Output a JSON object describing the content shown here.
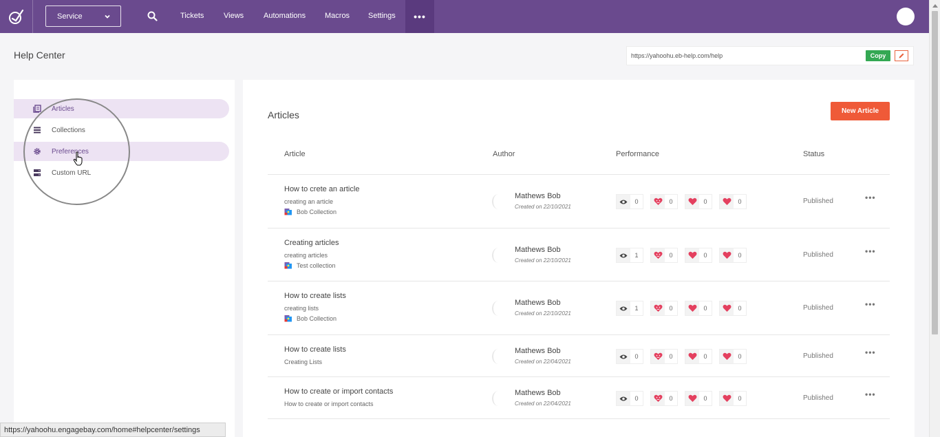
{
  "nav": {
    "service_label": "Service",
    "links": [
      "Tickets",
      "Views",
      "Automations",
      "Macros",
      "Settings"
    ],
    "more_label": "•••"
  },
  "header": {
    "title": "Help Center",
    "url": "https://yahoohu.eb-help.com/help",
    "copy_label": "Copy"
  },
  "sidebar": {
    "items": [
      {
        "label": "Articles",
        "icon": "articles-icon"
      },
      {
        "label": "Collections",
        "icon": "collections-icon"
      },
      {
        "label": "Preferences",
        "icon": "gear-icon"
      },
      {
        "label": "Custom URL",
        "icon": "server-icon"
      }
    ]
  },
  "main": {
    "title": "Articles",
    "new_button": "New Article",
    "columns": [
      "Article",
      "Author",
      "Performance",
      "Status"
    ],
    "rows": [
      {
        "title": "How to crete an article",
        "subtitle": "creating an article",
        "collection": "Bob Collection",
        "author": "Mathews Bob",
        "created": "Created on 22/10/2021",
        "views": "0",
        "r1": "0",
        "r2": "0",
        "r3": "0",
        "status": "Published"
      },
      {
        "title": "Creating articles",
        "subtitle": "creating articles",
        "collection": "Test collection",
        "author": "Mathews Bob",
        "created": "Created on 22/10/2021",
        "views": "1",
        "r1": "0",
        "r2": "0",
        "r3": "0",
        "status": "Published"
      },
      {
        "title": "How to create lists",
        "subtitle": "creating lists",
        "collection": "Bob Collection",
        "author": "Mathews Bob",
        "created": "Created on 22/10/2021",
        "views": "1",
        "r1": "0",
        "r2": "0",
        "r3": "0",
        "status": "Published"
      },
      {
        "title": "How to create lists",
        "subtitle": "Creating Lists",
        "collection": "",
        "author": "Mathews Bob",
        "created": "Created on 22/04/2021",
        "views": "0",
        "r1": "0",
        "r2": "0",
        "r3": "0",
        "status": "Published"
      },
      {
        "title": "How to create or import contacts",
        "subtitle": "How to create or import contacts",
        "collection": "",
        "author": "Mathews Bob",
        "created": "Created on 22/04/2021",
        "views": "0",
        "r1": "0",
        "r2": "0",
        "r3": "0",
        "status": "Published"
      }
    ]
  },
  "statusbar": {
    "url": "https://yahoohu.engagebay.com/home#helpcenter/settings"
  },
  "colors": {
    "brand": "#6a4a8e",
    "accent": "#ef5a38",
    "copy": "#34a853",
    "heart": "#e4405f"
  }
}
